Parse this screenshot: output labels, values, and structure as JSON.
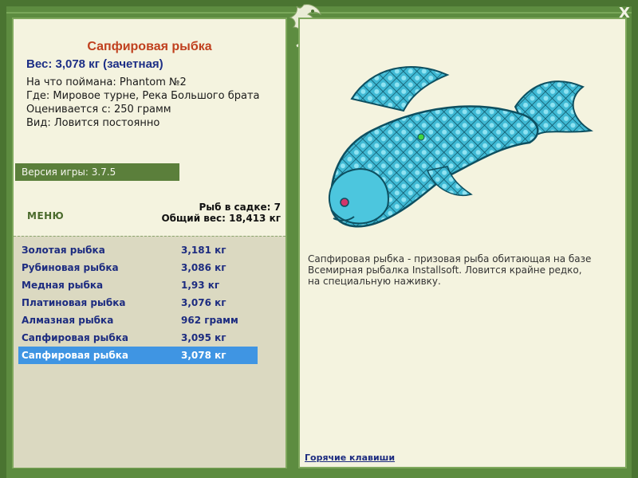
{
  "window": {
    "close_label": "X"
  },
  "fish_detail": {
    "title": "Сапфировая рыбка",
    "weight_line": "Вес: 3,078 кг (зачетная)",
    "caught_with": "На что поймана: Phantom №2",
    "where": "Где: Мировое турне, Река Большого брата",
    "valued_from": "Оценивается с: 250 грамм",
    "kind": "Вид: Ловится постоянно"
  },
  "version_label": "Версия игры: 3.7.5",
  "menu_label": "МЕНЮ",
  "stats": {
    "fish_count": "Рыб в садке: 7",
    "total_weight": "Общий вес: 18,413 кг"
  },
  "fish_list": [
    {
      "name": "Золотая рыбка",
      "weight": "3,181 кг"
    },
    {
      "name": "Рубиновая рыбка",
      "weight": "3,086 кг"
    },
    {
      "name": "Медная рыбка",
      "weight": "1,93 кг"
    },
    {
      "name": "Платиновая рыбка",
      "weight": "3,076 кг"
    },
    {
      "name": "Алмазная рыбка",
      "weight": "962 грамм"
    },
    {
      "name": "Сапфировая рыбка",
      "weight": "3,095 кг"
    },
    {
      "name": "Сапфировая рыбка",
      "weight": "3,078 кг"
    }
  ],
  "selected_index": 6,
  "description": "Сапфировая рыбка - призовая рыба обитающая на базе Всемирная рыбалка Installsoft. Ловится крайне редко, на специальную наживку.",
  "hotkeys_label": "Горячие клавиши",
  "colors": {
    "accent_green": "#5d8c40",
    "title_orange": "#c0401e",
    "list_text_blue": "#1d2c80",
    "selection_blue": "#3f95e3",
    "fish_cyan": "#3fb9d4"
  }
}
